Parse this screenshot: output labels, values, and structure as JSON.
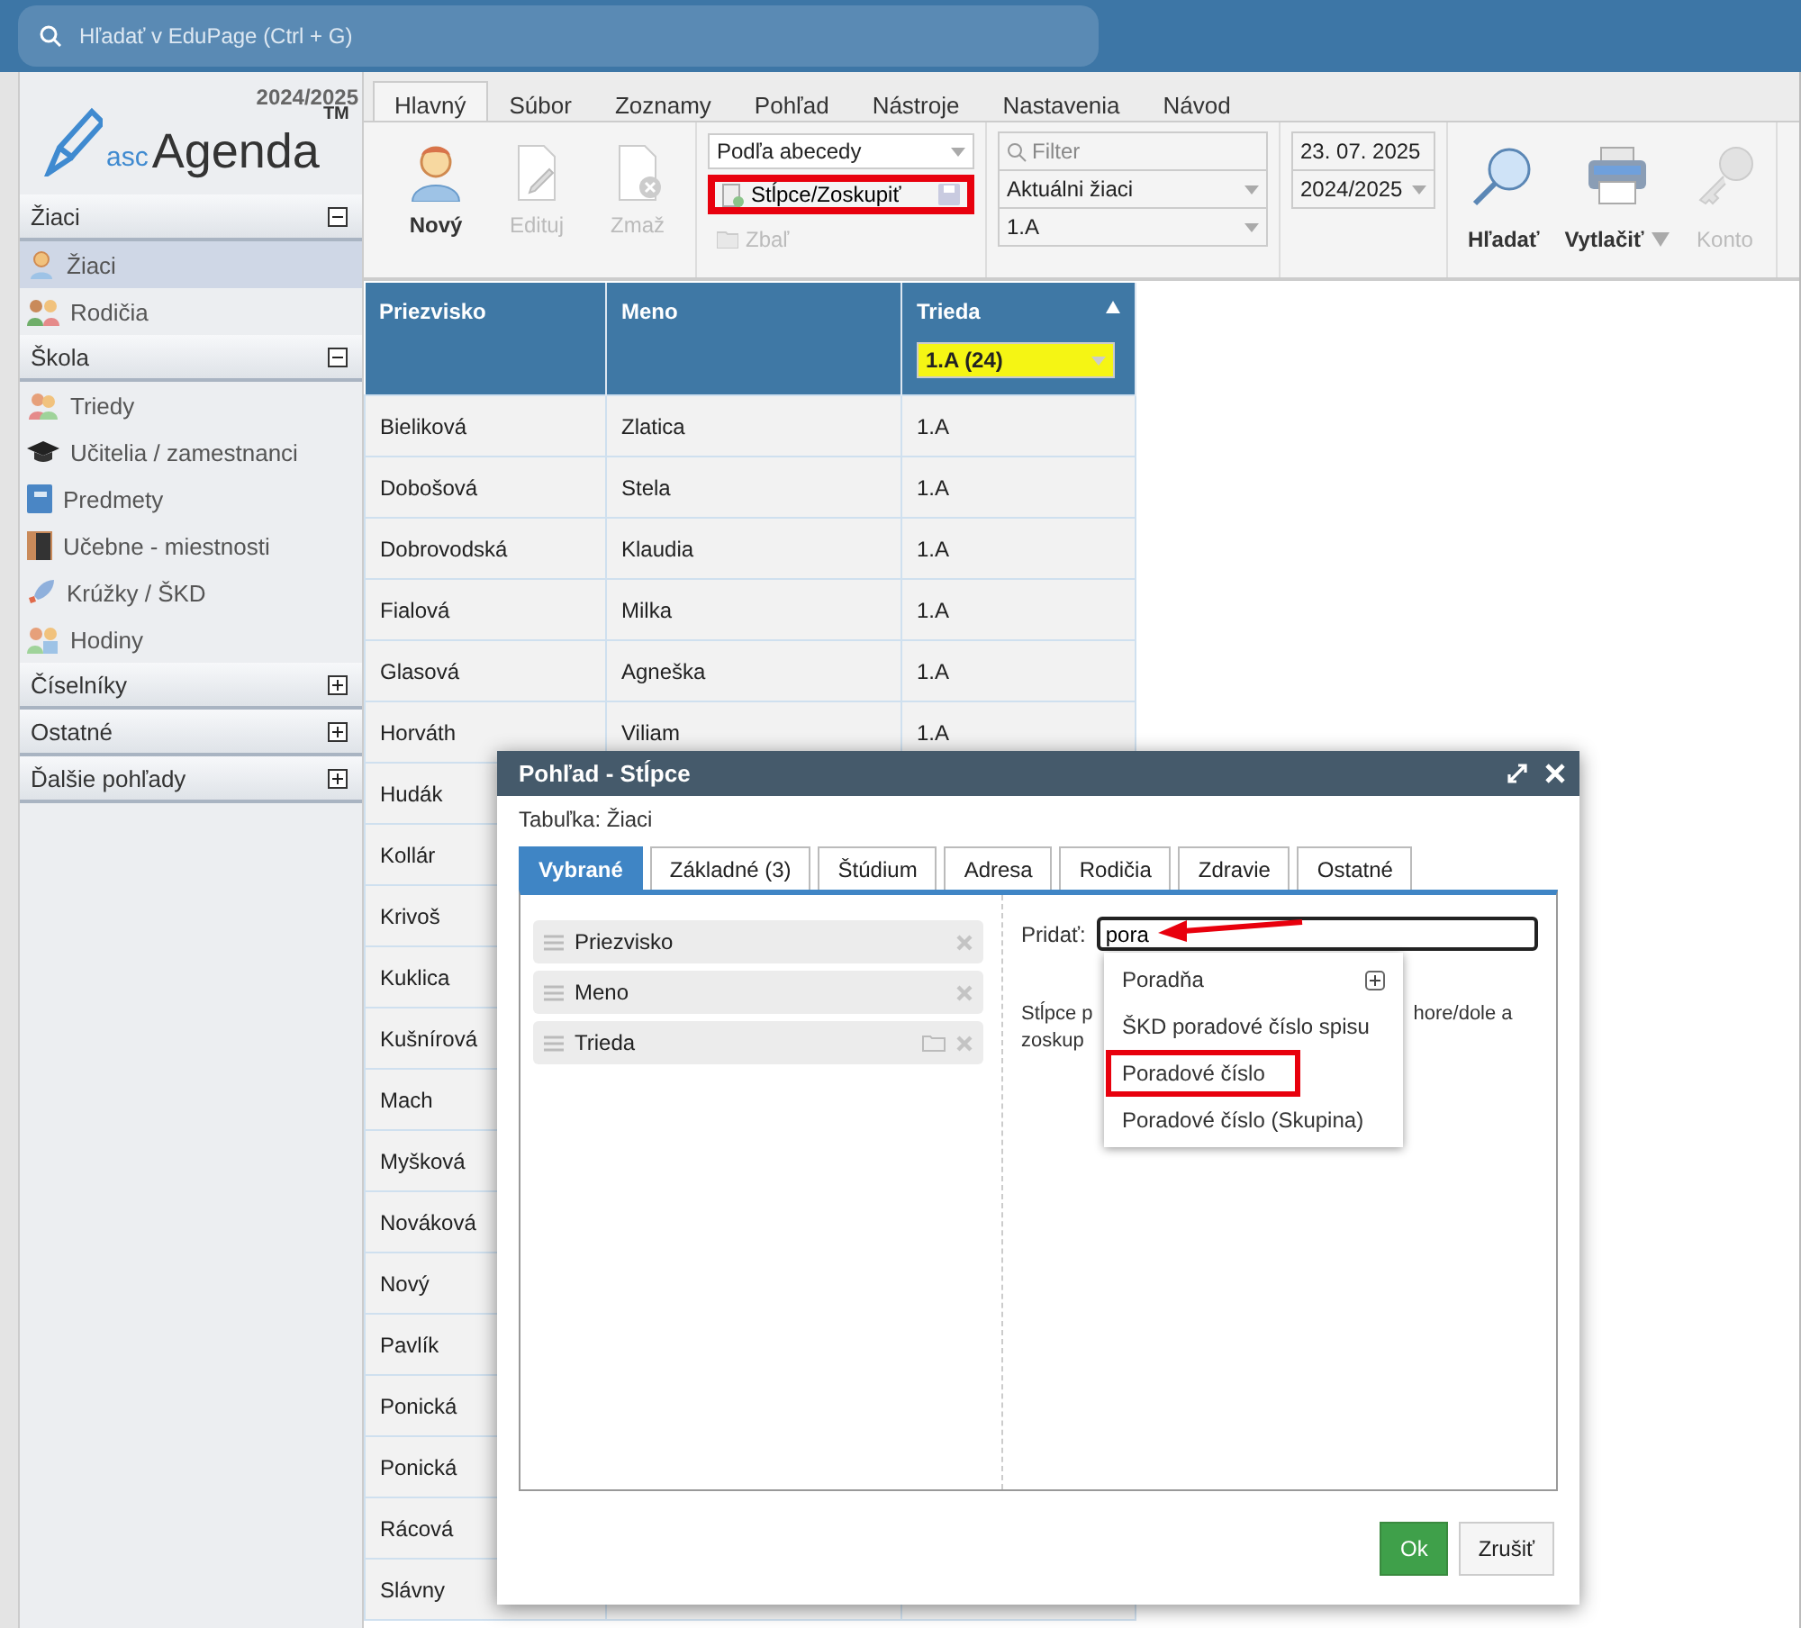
{
  "search": {
    "placeholder": "Hľadať v EduPage (Ctrl + G)"
  },
  "logo": {
    "year": "2024/2025",
    "prefix": "asc",
    "name": "Agenda",
    "mark": "TM"
  },
  "sidebar": [
    {
      "label": "Žiaci",
      "expanded": true,
      "items": [
        {
          "label": "Žiaci",
          "selected": true
        },
        {
          "label": "Rodičia",
          "selected": false
        }
      ]
    },
    {
      "label": "Škola",
      "expanded": true,
      "items": [
        {
          "label": "Triedy",
          "selected": false
        },
        {
          "label": "Učitelia / zamestnanci",
          "selected": false
        },
        {
          "label": "Predmety",
          "selected": false
        },
        {
          "label": "Učebne - miestnosti",
          "selected": false
        },
        {
          "label": "Krúžky / ŠKD",
          "selected": false
        },
        {
          "label": "Hodiny",
          "selected": false
        }
      ]
    },
    {
      "label": "Číselníky",
      "expanded": false
    },
    {
      "label": "Ostatné",
      "expanded": false
    },
    {
      "label": "Ďalšie pohľady",
      "expanded": false
    }
  ],
  "ribbon_tabs": [
    {
      "label": "Hlavný",
      "selected": true
    },
    {
      "label": "Súbor",
      "selected": false
    },
    {
      "label": "Zoznamy",
      "selected": false
    },
    {
      "label": "Pohľad",
      "selected": false
    },
    {
      "label": "Nástroje",
      "selected": false
    },
    {
      "label": "Nastavenia",
      "selected": false
    },
    {
      "label": "Návod",
      "selected": false
    }
  ],
  "ribbon": {
    "record_buttons": [
      {
        "label": "Nový",
        "disabled": false
      },
      {
        "label": "Edituj",
        "disabled": true
      },
      {
        "label": "Zmaž",
        "disabled": true
      }
    ],
    "sort": {
      "value": "Podľa abecedy"
    },
    "columns_button": {
      "label": "Stĺpce/Zoskupiť",
      "highlighted": true
    },
    "collapse_button": {
      "label": "Zbaľ",
      "disabled": true
    },
    "filter": {
      "placeholder": "Filter"
    },
    "scope": {
      "value": "Aktuálni žiaci"
    },
    "class": {
      "value": "1.A"
    },
    "date": {
      "value": "23. 07. 2025"
    },
    "year": {
      "value": "2024/2025"
    },
    "tool_buttons": [
      {
        "label": "Hľadať",
        "disabled": false,
        "menu": false
      },
      {
        "label": "Vytlačiť",
        "disabled": false,
        "menu": true
      },
      {
        "label": "Konto",
        "disabled": true,
        "menu": false
      }
    ]
  },
  "table": {
    "columns": [
      "Priezvisko",
      "Meno",
      "Trieda"
    ],
    "filter": "1.A (24)",
    "rows": [
      {
        "surname": "Bieliková",
        "name": "Zlatica",
        "class": "1.A"
      },
      {
        "surname": "Dobošová",
        "name": "Stela",
        "class": "1.A"
      },
      {
        "surname": "Dobrovodská",
        "name": "Klaudia",
        "class": "1.A"
      },
      {
        "surname": "Fialová",
        "name": "Milka",
        "class": "1.A"
      },
      {
        "surname": "Glasová",
        "name": "Agneška",
        "class": "1.A"
      },
      {
        "surname": "Horváth",
        "name": "Viliam",
        "class": "1.A"
      },
      {
        "surname": "Hudák"
      },
      {
        "surname": "Kollár"
      },
      {
        "surname": "Krivoš"
      },
      {
        "surname": "Kuklica"
      },
      {
        "surname": "Kušnírová"
      },
      {
        "surname": "Mach"
      },
      {
        "surname": "Myšková"
      },
      {
        "surname": "Nováková"
      },
      {
        "surname": "Nový"
      },
      {
        "surname": "Pavlík"
      },
      {
        "surname": "Ponická"
      },
      {
        "surname": "Ponická"
      },
      {
        "surname": "Rácová"
      },
      {
        "surname": "Slávny"
      }
    ]
  },
  "dialog": {
    "title": "Pohľad - Stĺpce",
    "subtitle": "Tabuľka: Žiaci",
    "tabs": [
      {
        "label": "Vybrané",
        "selected": true
      },
      {
        "label": "Základné (3)",
        "selected": false
      },
      {
        "label": "Štúdium",
        "selected": false
      },
      {
        "label": "Adresa",
        "selected": false
      },
      {
        "label": "Rodičia",
        "selected": false
      },
      {
        "label": "Zdravie",
        "selected": false
      },
      {
        "label": "Ostatné",
        "selected": false
      }
    ],
    "selected_columns": [
      {
        "label": "Priezvisko",
        "groupable": false
      },
      {
        "label": "Meno",
        "groupable": false
      },
      {
        "label": "Trieda",
        "groupable": true
      }
    ],
    "add_label": "Pridať:",
    "add_value": "pora",
    "hint": [
      "Stĺpce p",
      "hore/dole a",
      "zoskup"
    ],
    "suggestions": [
      {
        "label": "Poradňa",
        "expandable": true,
        "highlighted": false
      },
      {
        "label": "ŠKD poradové číslo spisu",
        "expandable": false,
        "highlighted": false
      },
      {
        "label": "Poradové číslo",
        "expandable": false,
        "highlighted": true
      },
      {
        "label": "Poradové číslo (Skupina)",
        "expandable": false,
        "highlighted": false
      }
    ],
    "buttons": [
      {
        "label": "Ok",
        "kind": "primary"
      },
      {
        "label": "Zrušiť",
        "kind": "secondary"
      }
    ]
  }
}
